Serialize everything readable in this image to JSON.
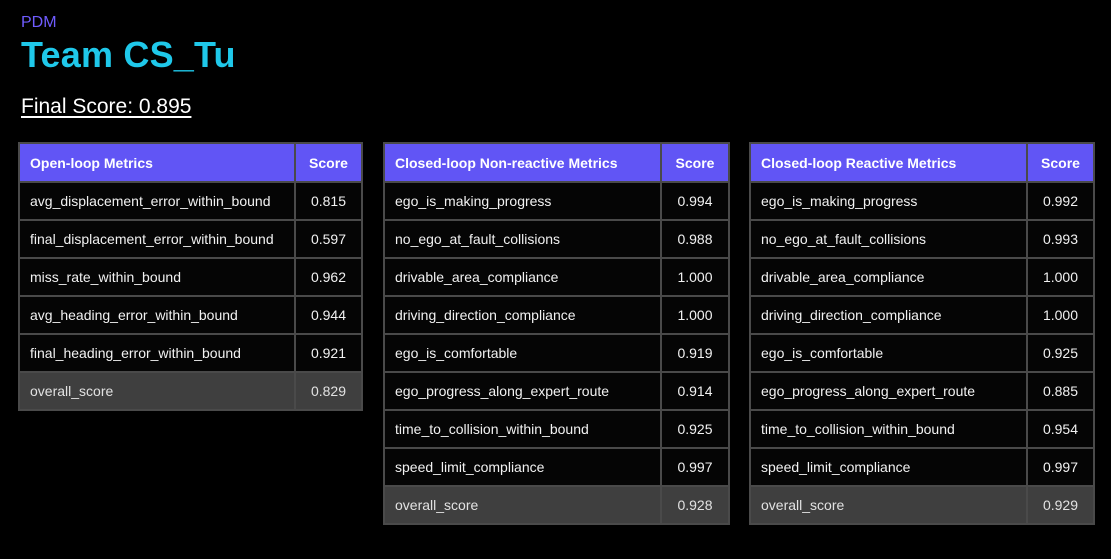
{
  "header": {
    "subtitle": "PDM",
    "title": "Team CS_Tu",
    "final_score": "Final Score: 0.895"
  },
  "colors": {
    "subtitle": "#6f5cff",
    "title": "#1fc8ea",
    "header_row": "#6155f5",
    "overall_row": "#3f3f3f",
    "background": "#000000"
  },
  "tables": [
    {
      "heading": "Open-loop Metrics",
      "score_heading": "Score",
      "rows": [
        {
          "metric": "avg_displacement_error_within_bound",
          "score": "0.815"
        },
        {
          "metric": "final_displacement_error_within_bound",
          "score": "0.597"
        },
        {
          "metric": "miss_rate_within_bound",
          "score": "0.962"
        },
        {
          "metric": "avg_heading_error_within_bound",
          "score": "0.944"
        },
        {
          "metric": "final_heading_error_within_bound",
          "score": "0.921"
        },
        {
          "metric": "overall_score",
          "score": "0.829"
        }
      ]
    },
    {
      "heading": "Closed-loop Non-reactive Metrics",
      "score_heading": "Score",
      "rows": [
        {
          "metric": "ego_is_making_progress",
          "score": "0.994"
        },
        {
          "metric": "no_ego_at_fault_collisions",
          "score": "0.988"
        },
        {
          "metric": "drivable_area_compliance",
          "score": "1.000"
        },
        {
          "metric": "driving_direction_compliance",
          "score": "1.000"
        },
        {
          "metric": "ego_is_comfortable",
          "score": "0.919"
        },
        {
          "metric": "ego_progress_along_expert_route",
          "score": "0.914"
        },
        {
          "metric": "time_to_collision_within_bound",
          "score": "0.925"
        },
        {
          "metric": "speed_limit_compliance",
          "score": "0.997"
        },
        {
          "metric": "overall_score",
          "score": "0.928"
        }
      ]
    },
    {
      "heading": "Closed-loop Reactive Metrics",
      "score_heading": "Score",
      "rows": [
        {
          "metric": "ego_is_making_progress",
          "score": "0.992"
        },
        {
          "metric": "no_ego_at_fault_collisions",
          "score": "0.993"
        },
        {
          "metric": "drivable_area_compliance",
          "score": "1.000"
        },
        {
          "metric": "driving_direction_compliance",
          "score": "1.000"
        },
        {
          "metric": "ego_is_comfortable",
          "score": "0.925"
        },
        {
          "metric": "ego_progress_along_expert_route",
          "score": "0.885"
        },
        {
          "metric": "time_to_collision_within_bound",
          "score": "0.954"
        },
        {
          "metric": "speed_limit_compliance",
          "score": "0.997"
        },
        {
          "metric": "overall_score",
          "score": "0.929"
        }
      ]
    }
  ]
}
